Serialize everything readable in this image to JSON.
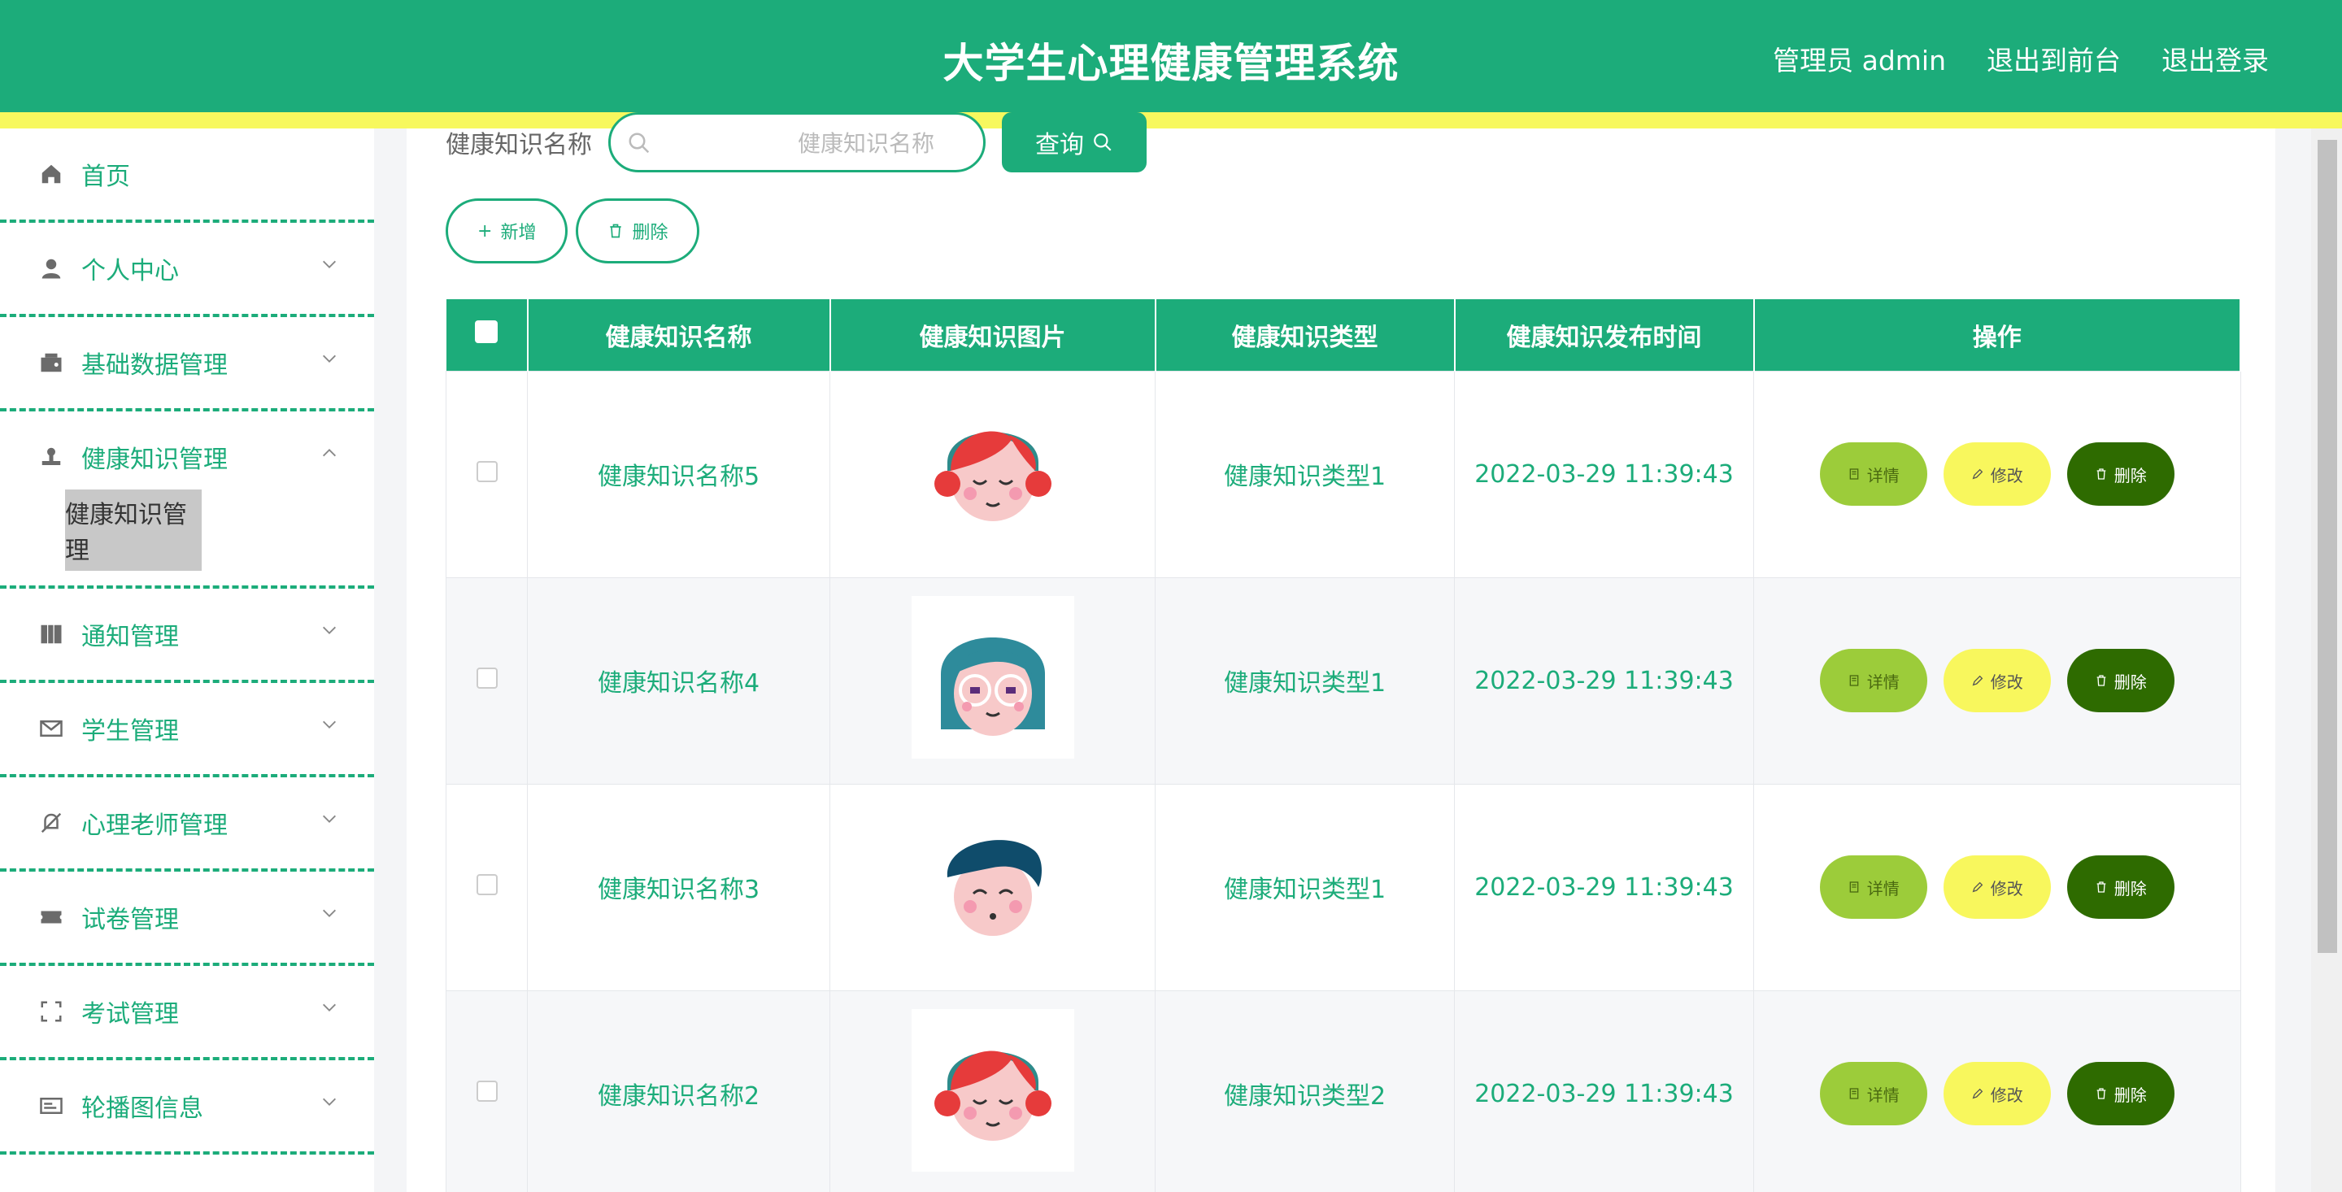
{
  "header": {
    "title": "大学生心理健康管理系统",
    "admin": "管理员 admin",
    "front": "退出到前台",
    "logout": "退出登录",
    "colors": {
      "brand": "#1cac7a",
      "stripe": "#f7f85e"
    }
  },
  "sidebar": {
    "items": [
      {
        "label": "首页",
        "icon": "home-icon"
      },
      {
        "label": "个人中心",
        "icon": "user-icon"
      },
      {
        "label": "基础数据管理",
        "icon": "wallet-icon"
      },
      {
        "label": "健康知识管理",
        "icon": "stamp-icon",
        "sub": "健康知识管理"
      },
      {
        "label": "通知管理",
        "icon": "book-icon"
      },
      {
        "label": "学生管理",
        "icon": "mail-icon"
      },
      {
        "label": "心理老师管理",
        "icon": "bell-off-icon"
      },
      {
        "label": "试卷管理",
        "icon": "ticket-icon"
      },
      {
        "label": "考试管理",
        "icon": "fullscreen-icon"
      },
      {
        "label": "轮播图信息",
        "icon": "card-icon"
      }
    ]
  },
  "search": {
    "label": "健康知识名称",
    "placeholder": "健康知识名称",
    "button": "查询"
  },
  "toolbar": {
    "add": "新增",
    "delete": "删除"
  },
  "table": {
    "headers": [
      "健康知识名称",
      "健康知识图片",
      "健康知识类型",
      "健康知识发布时间",
      "操作"
    ],
    "rows": [
      {
        "name": "健康知识名称5",
        "type": "健康知识类型1",
        "time": "2022-03-29 11:39:43",
        "avatar": "girl-red-hair"
      },
      {
        "name": "健康知识名称4",
        "type": "健康知识类型1",
        "time": "2022-03-29 11:39:43",
        "avatar": "girl-glasses"
      },
      {
        "name": "健康知识名称3",
        "type": "健康知识类型1",
        "time": "2022-03-29 11:39:43",
        "avatar": "boy-navy-hair"
      },
      {
        "name": "健康知识名称2",
        "type": "健康知识类型2",
        "time": "2022-03-29 11:39:43",
        "avatar": "girl-red-hair"
      }
    ],
    "ops": {
      "detail": "详情",
      "edit": "修改",
      "delete": "删除"
    }
  }
}
